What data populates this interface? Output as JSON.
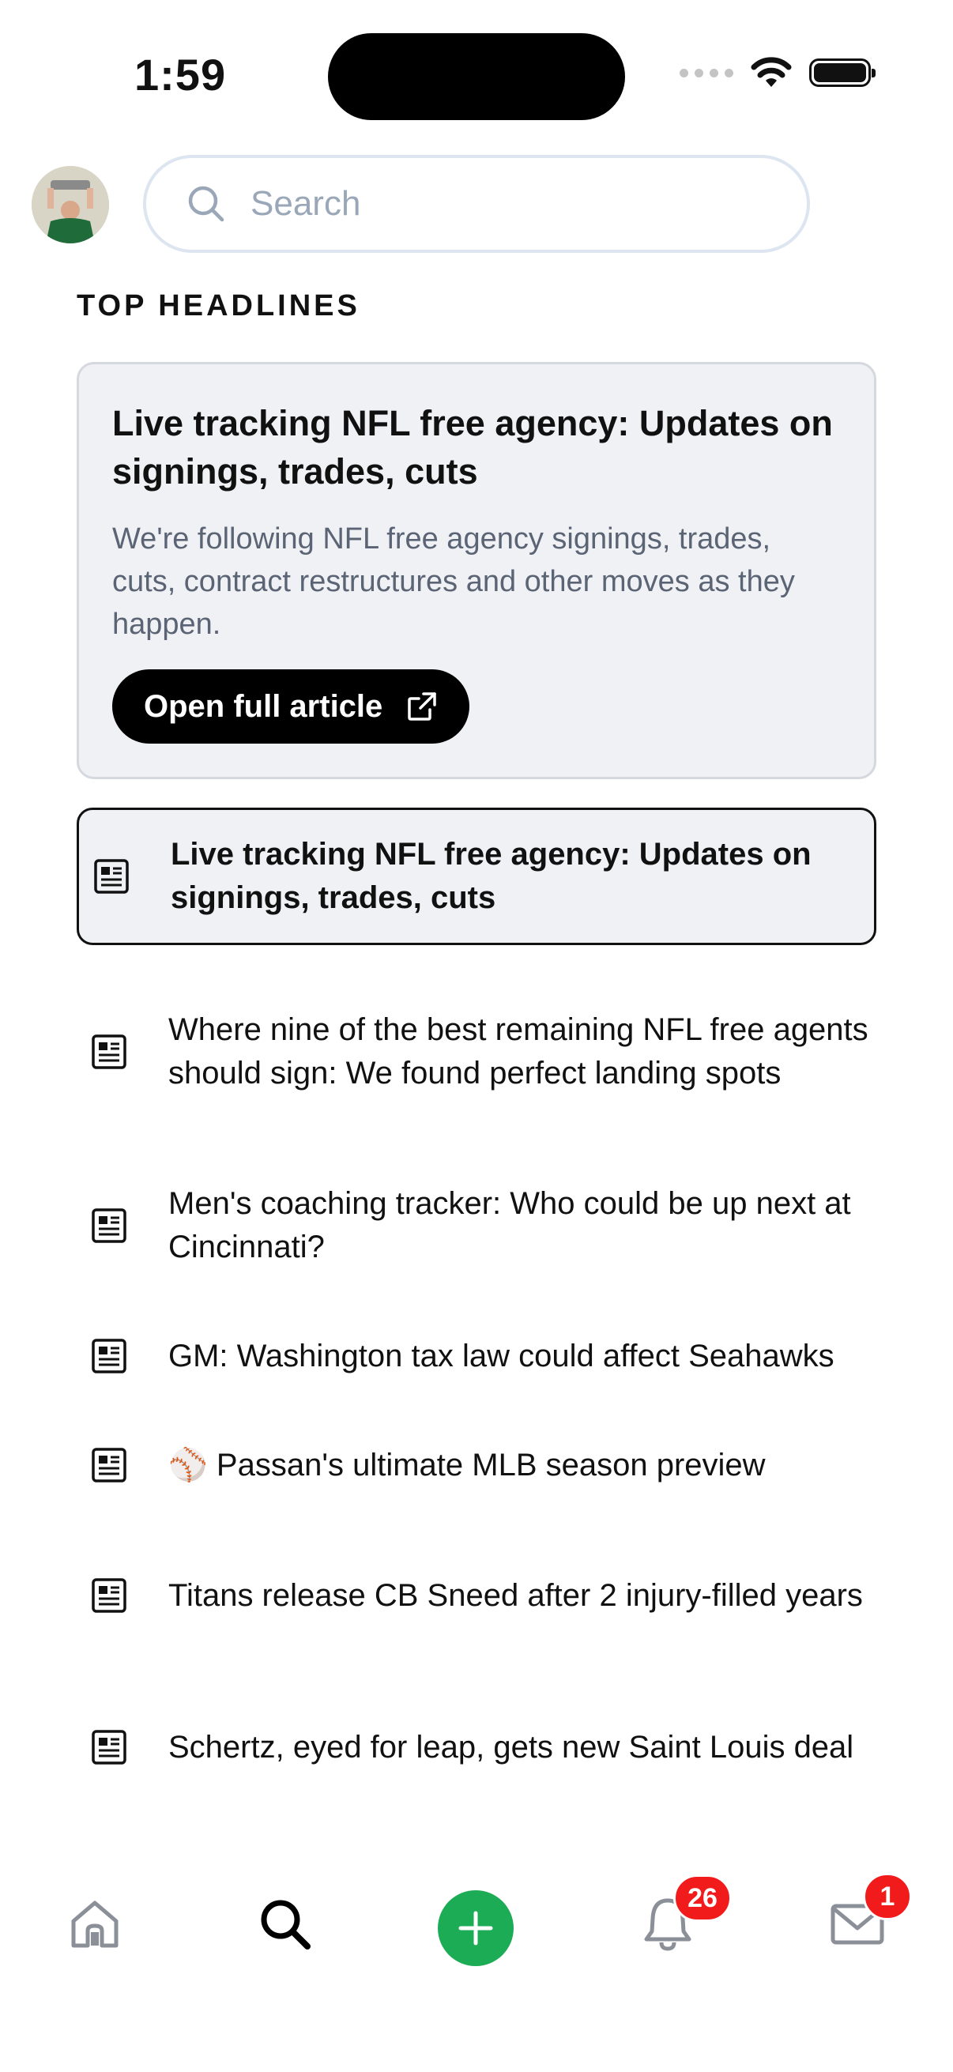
{
  "status_bar": {
    "time": "1:59"
  },
  "search": {
    "placeholder": "Search"
  },
  "section_title": "TOP HEADLINES",
  "featured": {
    "title": "Live tracking NFL free agency: Updates on signings, trades, cuts",
    "description": "We're following NFL free agency signings, trades, cuts, contract restructures and other moves as they happen.",
    "button_label": "Open full article"
  },
  "headlines": [
    {
      "text": "Live tracking NFL free agency: Updates on signings, trades, cuts",
      "selected": true
    },
    {
      "text": "Where nine of the best remaining NFL free agents should sign: We found perfect landing spots"
    },
    {
      "text": "Men's coaching tracker: Who could be up next at Cincinnati?"
    },
    {
      "text": "GM: Washington tax law could affect Seahawks"
    },
    {
      "text": "⚾ Passan's ultimate MLB season preview"
    },
    {
      "text": "Titans release CB Sneed after 2 injury-filled years"
    },
    {
      "text": "Schertz, eyed for leap, gets new Saint Louis deal"
    }
  ],
  "tab_bar": {
    "notifications_badge": "26",
    "messages_badge": "1",
    "icons": [
      "home-icon",
      "search-icon",
      "plus-icon",
      "bell-icon",
      "mail-icon"
    ]
  },
  "colors": {
    "accent_green": "#1dac56",
    "badge_red": "#f21b1b",
    "card_bg": "#f0f1f5"
  }
}
